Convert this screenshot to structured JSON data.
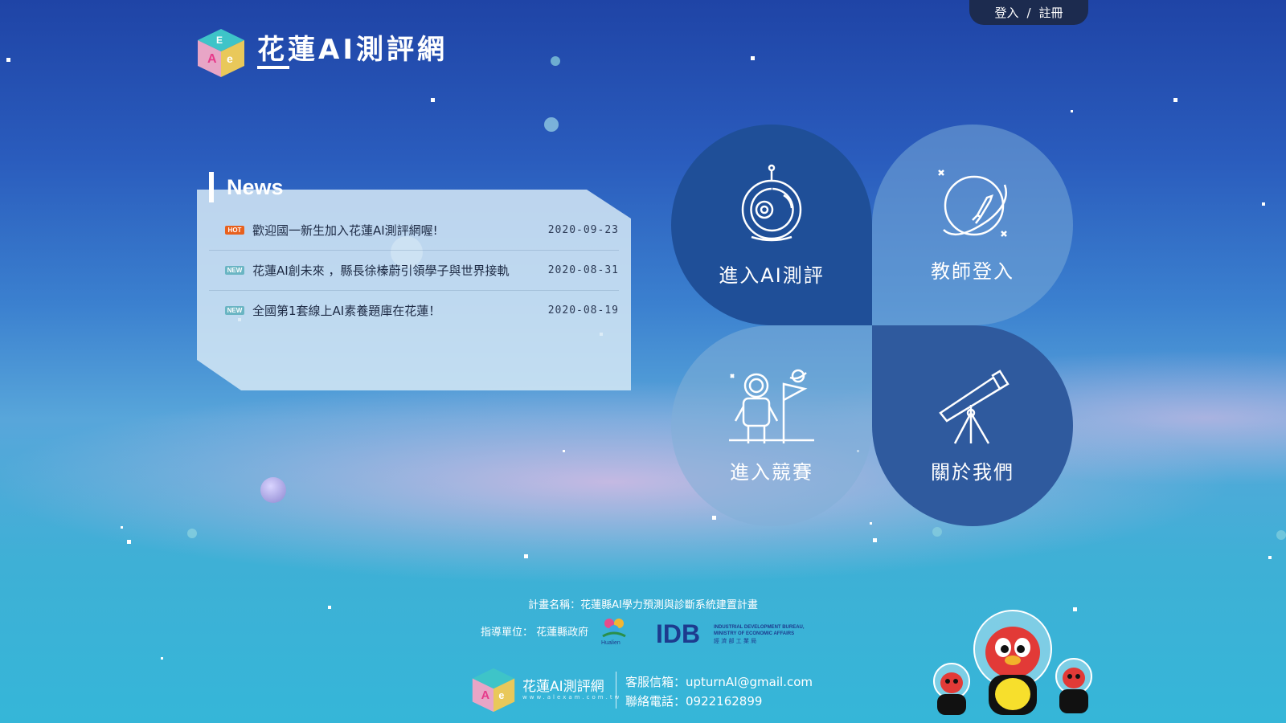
{
  "header": {
    "site_title": "花蓮AI測評網",
    "login_label": "登入",
    "separator": "/",
    "register_label": "註冊"
  },
  "news": {
    "title": "News",
    "items": [
      {
        "badge": "HOT",
        "text": "歡迎國一新生加入花蓮AI測評網喔!",
        "date": "2020-09-23"
      },
      {
        "badge": "NEW",
        "text": "花蓮AI創未來 ，縣長徐榛蔚引領學子與世界接軌",
        "date": "2020-08-31"
      },
      {
        "badge": "NEW",
        "text": "全國第1套線上AI素養題庫在花蓮！",
        "date": "2020-08-19"
      }
    ]
  },
  "menu": {
    "enter_assessment": "進入AI測評",
    "teacher_login": "教師登入",
    "enter_competition": "進入競賽",
    "about_us": "關於我們"
  },
  "footer": {
    "plan_name": "計畫名稱：花蓮縣AI學力預測與診斷系統建置計畫",
    "guide_unit": "指導單位： 花蓮縣政府",
    "hualien_text": "Hualien",
    "idb_text": "IDB",
    "idb_en_line1": "INDUSTRIAL DEVELOPMENT BUREAU,",
    "idb_en_line2": "MINISTRY OF ECONOMIC AFFAIRS",
    "idb_zh": "經 濟 部 工 業 局",
    "brand_name": "花蓮AI測評網",
    "brand_url": "www.alexam.com.tw",
    "email_line": "客服信箱：upturnAI@gmail.com",
    "phone_line": "聯絡電話：0922162899"
  },
  "colors": {
    "petal_dark": "#1f4f98",
    "petal_mid": "#2f5a9e",
    "hot_badge": "#e8601d",
    "new_badge": "#6ab5c3",
    "login_tab": "#1c2b4f"
  },
  "icons": [
    "logo-cube-icon",
    "astronaut-helmet-icon",
    "planet-rocket-icon",
    "astronaut-flag-icon",
    "telescope-icon",
    "penguin-mascot-icon"
  ]
}
